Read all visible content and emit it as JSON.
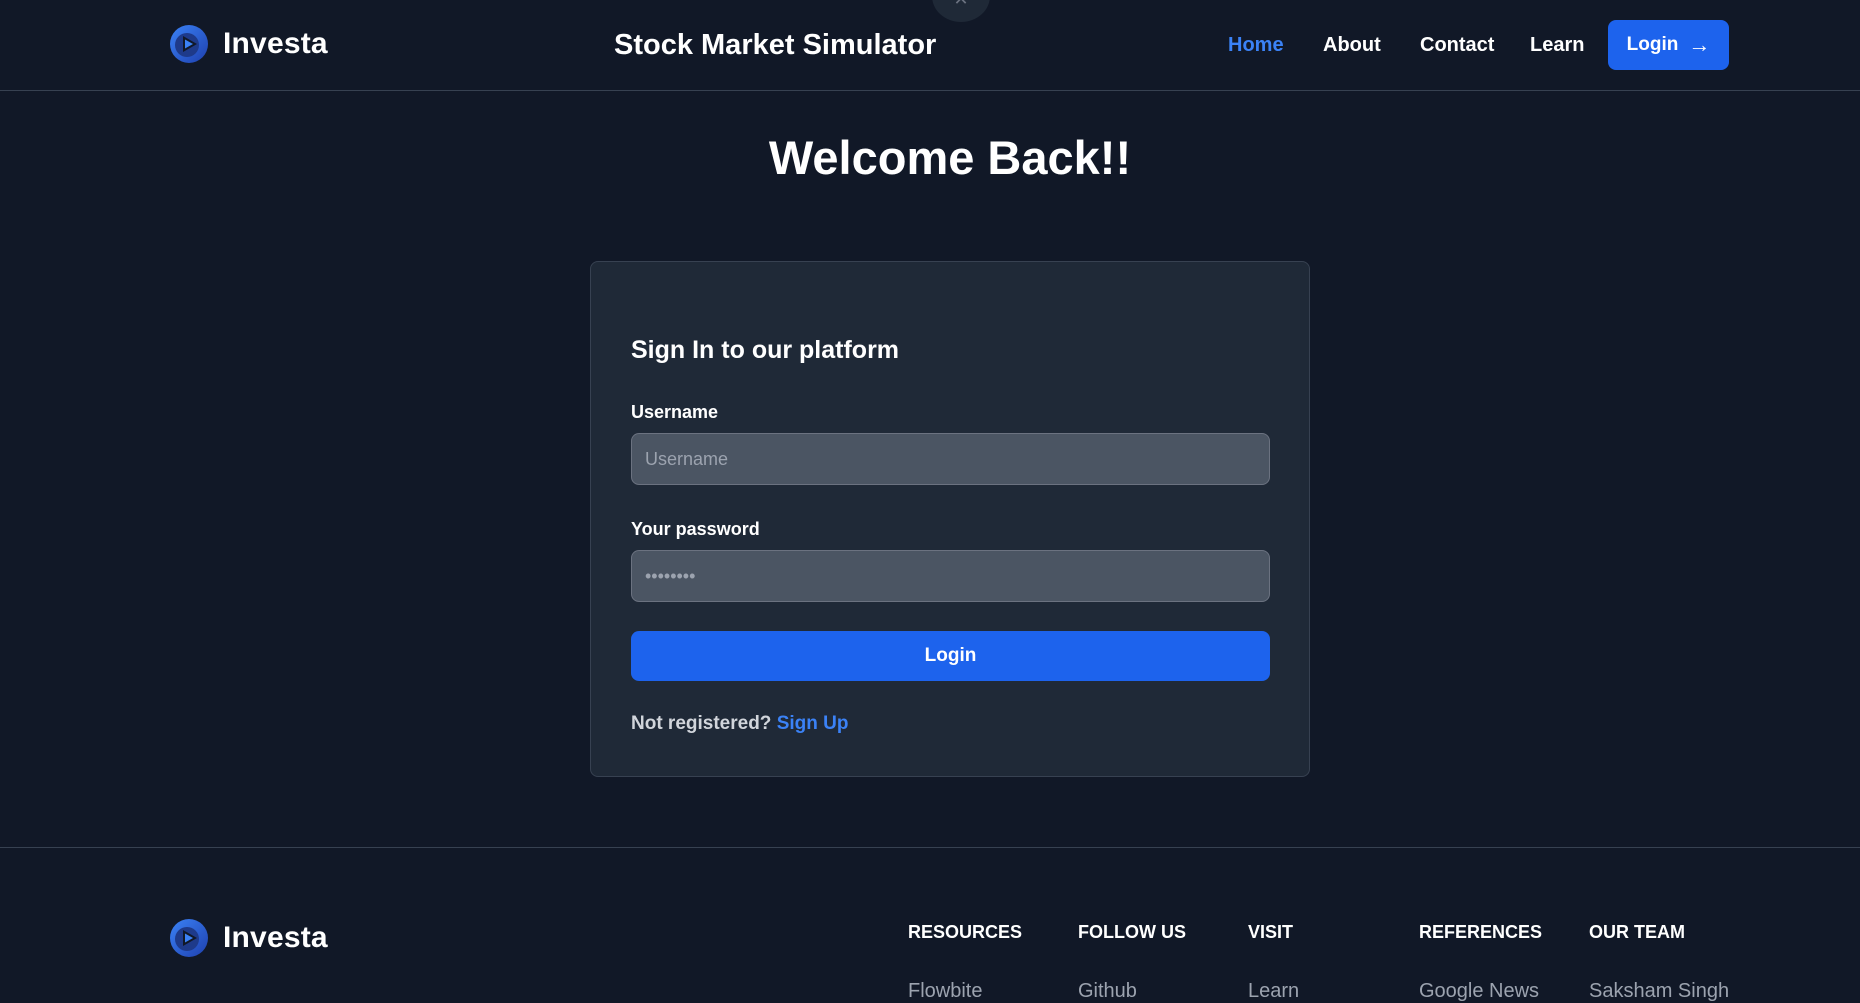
{
  "header": {
    "brand_name": "Investa",
    "site_title": "Stock Market Simulator",
    "close_glyph": "✕",
    "nav": [
      {
        "label": "Home",
        "active": true
      },
      {
        "label": "About",
        "active": false
      },
      {
        "label": "Contact",
        "active": false
      },
      {
        "label": "Learn",
        "active": false
      }
    ],
    "login_label": "Login",
    "login_arrow": "→"
  },
  "main": {
    "welcome": "Welcome Back!!",
    "card": {
      "title": "Sign In to our platform",
      "username_label": "Username",
      "username_placeholder": "Username",
      "username_value": "",
      "password_label": "Your password",
      "password_placeholder": "••••••••",
      "password_value": "",
      "submit_label": "Login",
      "signup_prompt": "Not registered?",
      "signup_link": "Sign Up"
    }
  },
  "footer": {
    "brand_name": "Investa",
    "columns": [
      {
        "heading": "RESOURCES",
        "link": "Flowbite"
      },
      {
        "heading": "FOLLOW US",
        "link": "Github"
      },
      {
        "heading": "VISIT",
        "link": "Learn"
      },
      {
        "heading": "REFERENCES",
        "link": "Google News"
      },
      {
        "heading": "OUR TEAM",
        "link": "Saksham Singh"
      }
    ]
  },
  "colors": {
    "background": "#111827",
    "card": "#1f2937",
    "accent": "#1d63ed",
    "link": "#3b82f6",
    "input": "#4b5563"
  },
  "icons": {
    "logo": "play-circle-logo-icon",
    "arrow": "arrow-right-icon",
    "close": "close-icon"
  }
}
